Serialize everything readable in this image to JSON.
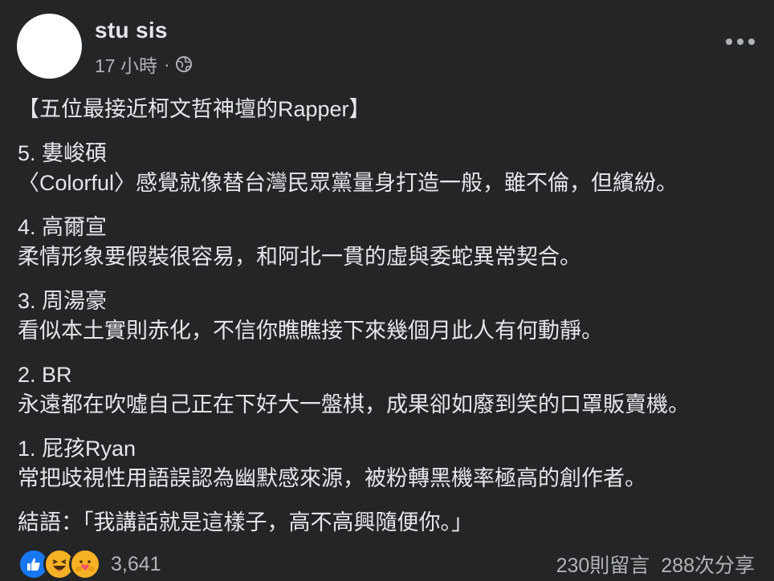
{
  "author": {
    "name": "stu sis"
  },
  "meta": {
    "time": "17 小時",
    "separator": "·",
    "privacy_icon": "globe-icon"
  },
  "content": {
    "title": "【五位最接近柯文哲神壇的Rapper】",
    "entries": [
      {
        "heading": "5. 婁峻碩",
        "text": "〈Colorful〉感覺就像替台灣民眾黨量身打造一般，雖不倫，但繽紛。"
      },
      {
        "heading": "4. 高爾宣",
        "text": "柔情形象要假裝很容易，和阿北一貫的虛與委蛇異常契合。"
      },
      {
        "heading": "3. 周湯豪",
        "text": "看似本土實則赤化，不信你瞧瞧接下來幾個月此人有何動靜。"
      },
      {
        "heading": "2. BR",
        "text": "永遠都在吹噓自己正在下好大一盤棋，成果卻如廢到笑的口罩販賣機。"
      },
      {
        "heading": "1. 屁孩Ryan",
        "text": "常把歧視性用語誤認為幽默感來源，被粉轉黑機率極高的創作者。"
      }
    ],
    "conclusion": "結語：「我講話就是這樣子，高不高興隨便你。」"
  },
  "footer": {
    "reactions": [
      "like-icon",
      "haha-icon",
      "care-icon"
    ],
    "reaction_count": "3,641",
    "comments": "230則留言",
    "shares": "288次分享"
  },
  "colors": {
    "background": "#242526",
    "primary_text": "#e4e6eb",
    "secondary_text": "#b0b3b8",
    "like_blue": "#1877f2",
    "emoji_yellow": "#f7b125"
  }
}
